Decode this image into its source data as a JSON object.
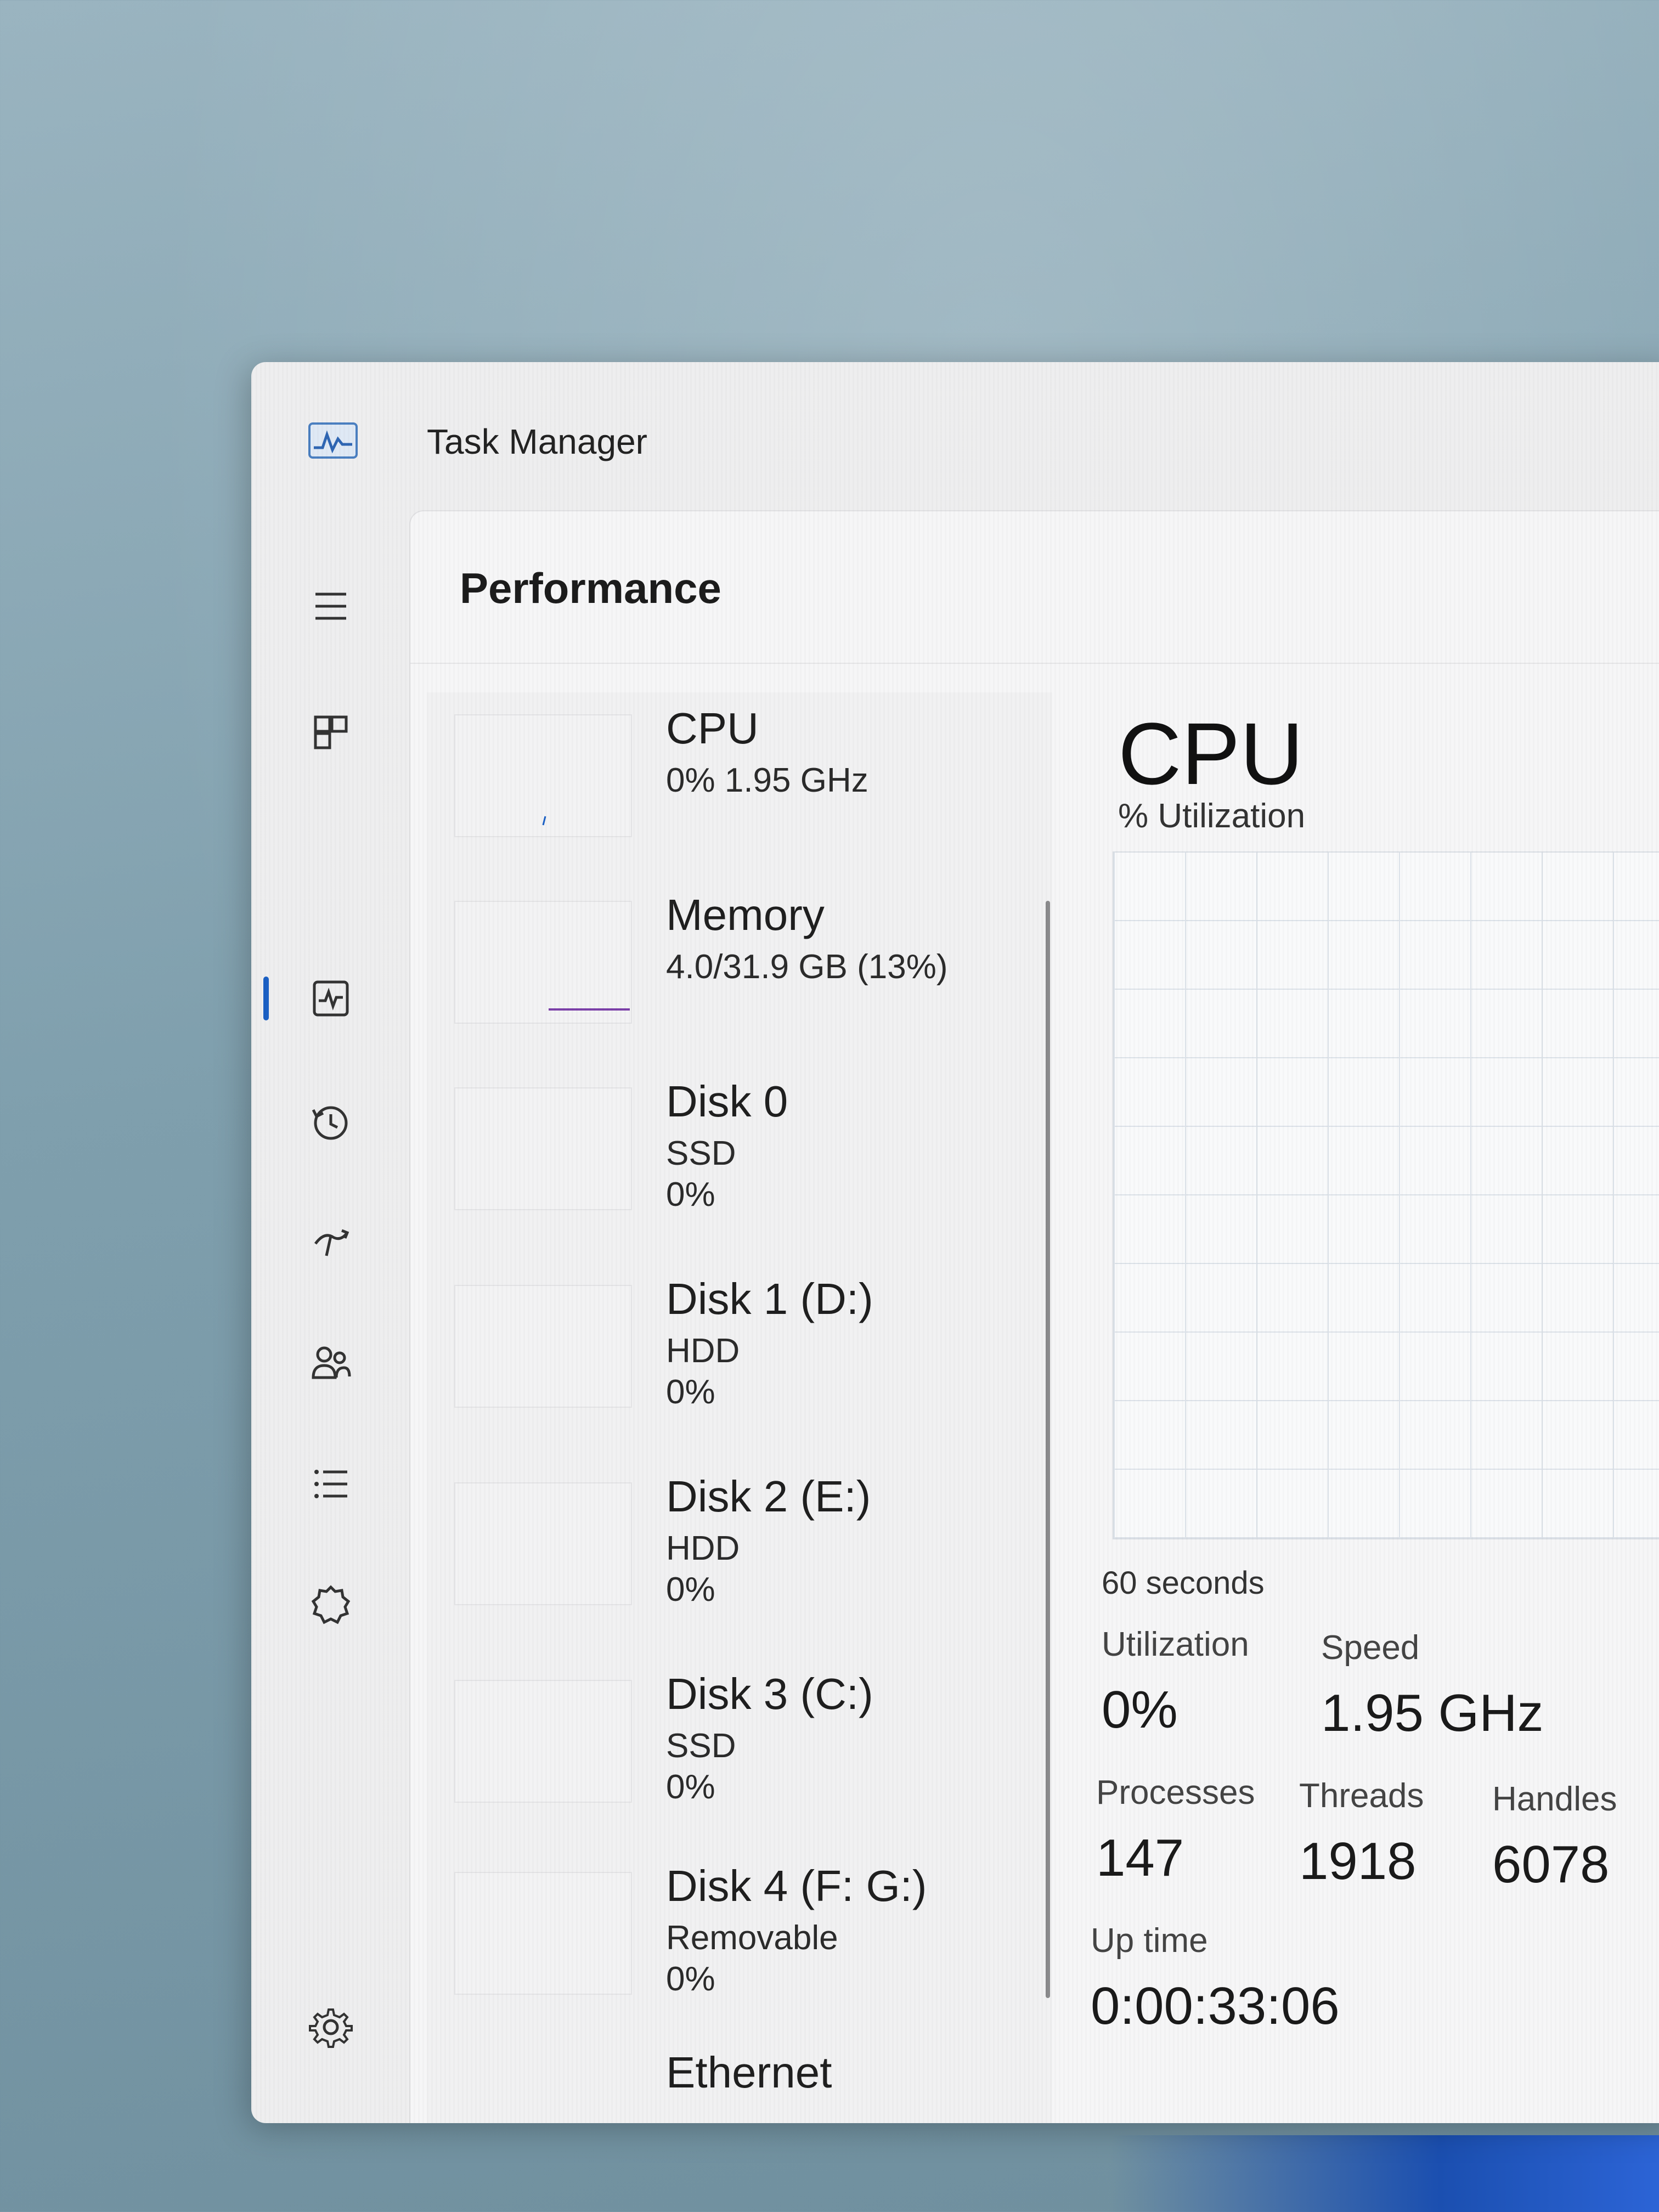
{
  "window": {
    "title": "Task Manager"
  },
  "nav": {
    "items": [
      {
        "icon": "hamburger-menu-icon"
      },
      {
        "icon": "processes-icon"
      },
      {
        "icon": "performance-icon",
        "active": true
      },
      {
        "icon": "app-history-icon"
      },
      {
        "icon": "startup-apps-icon"
      },
      {
        "icon": "users-icon"
      },
      {
        "icon": "details-icon"
      },
      {
        "icon": "services-icon"
      },
      {
        "icon": "settings-icon"
      }
    ],
    "accent": "#1b60c4"
  },
  "page": {
    "title": "Performance"
  },
  "resources": [
    {
      "name": "CPU",
      "line1": "0% 1.95 GHz",
      "line2": ""
    },
    {
      "name": "Memory",
      "line1": "4.0/31.9 GB (13%)",
      "line2": ""
    },
    {
      "name": "Disk 0",
      "line1": "SSD",
      "line2": "0%"
    },
    {
      "name": "Disk 1 (D:)",
      "line1": "HDD",
      "line2": "0%"
    },
    {
      "name": "Disk 2 (E:)",
      "line1": "HDD",
      "line2": "0%"
    },
    {
      "name": "Disk 3 (C:)",
      "line1": "SSD",
      "line2": "0%"
    },
    {
      "name": "Disk 4 (F: G:)",
      "line1": "Removable",
      "line2": "0%"
    },
    {
      "name": "Ethernet",
      "line1": "",
      "line2": ""
    }
  ],
  "detail": {
    "heading": "CPU",
    "graph_label": "% Utilization",
    "graph_axis": "60 seconds",
    "utilization_label": "Utilization",
    "utilization_value": "0%",
    "speed_label": "Speed",
    "speed_value": "1.95 GHz",
    "processes_label": "Processes",
    "processes_value": "147",
    "threads_label": "Threads",
    "threads_value": "1918",
    "handles_label": "Handles",
    "handles_value": "6078",
    "uptime_label": "Up time",
    "uptime_value": "0:00:33:06"
  },
  "colors": {
    "memory_line": "#7b3fa8",
    "cpu_line": "#1b60c4"
  }
}
